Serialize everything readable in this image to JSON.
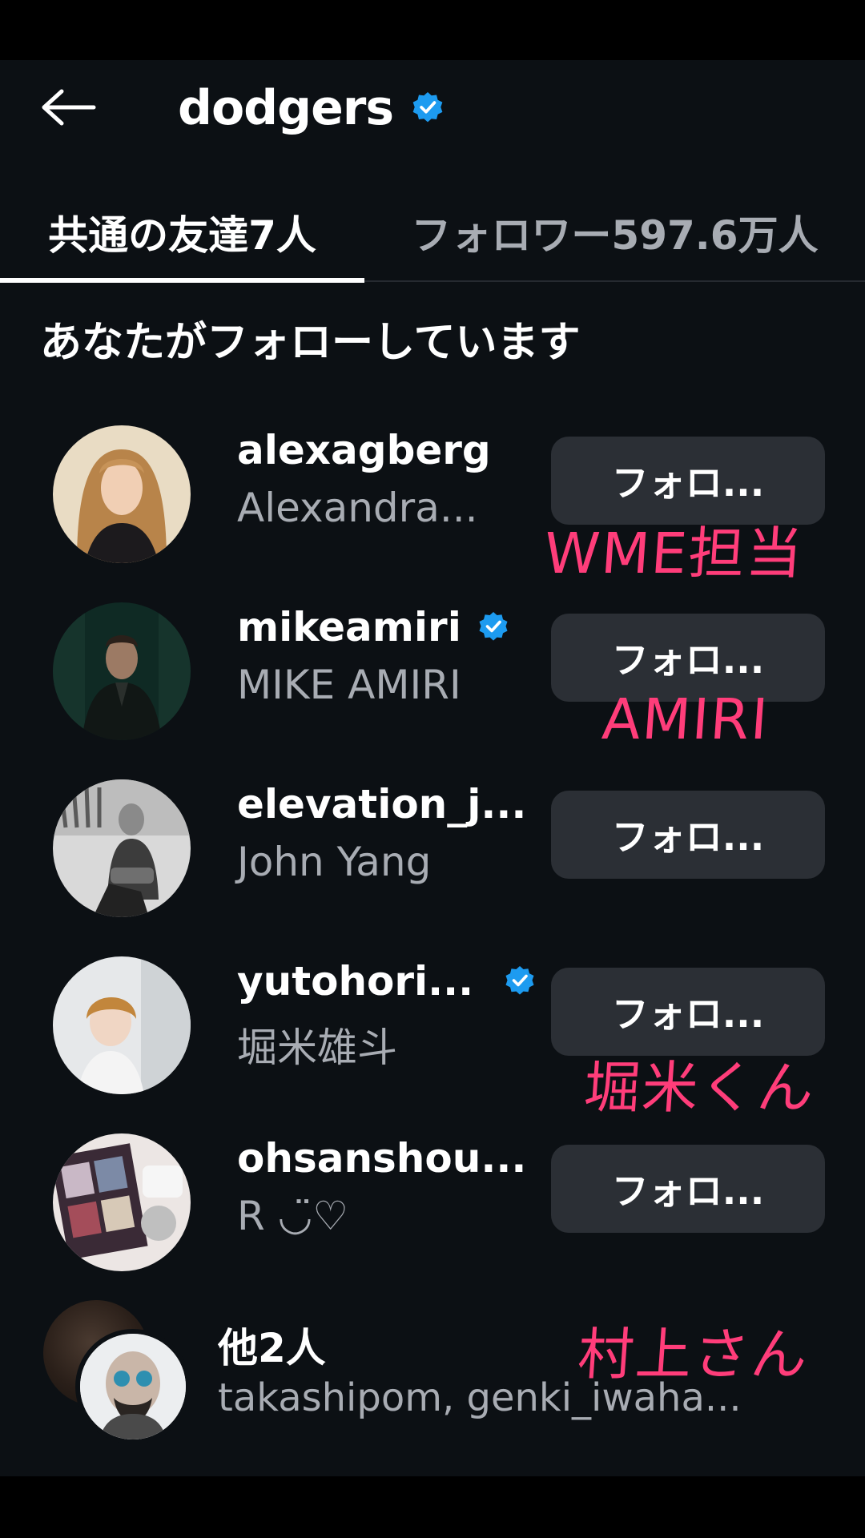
{
  "header": {
    "title": "dodgers",
    "back_icon": "arrow-left-icon",
    "verified_icon": "verified-badge-icon",
    "verified_color": "#0095f6"
  },
  "tabs": [
    {
      "label": "共通の友達7人",
      "active": true
    },
    {
      "label": "フォロワー597.6万人",
      "active": false
    }
  ],
  "section_heading": "あなたがフォローしています",
  "accounts": [
    {
      "username": "alexagberg",
      "full_name": "Alexandra...",
      "verified": false,
      "button": "フォロ..."
    },
    {
      "username": "mikeamiri",
      "full_name": "MIKE AMIRI",
      "verified": true,
      "button": "フォロ..."
    },
    {
      "username": "elevation_j...",
      "full_name": "John Yang",
      "verified": false,
      "button": "フォロ..."
    },
    {
      "username": "yutohori...",
      "full_name": "堀米雄斗",
      "verified": true,
      "button": "フォロ..."
    },
    {
      "username": "ohsanshou...",
      "full_name": "R ◡̈♡",
      "verified": false,
      "button": "フォロ..."
    }
  ],
  "others": {
    "title": "他2人",
    "names": "takashipom, genki_iwaha..."
  },
  "annotations": {
    "color": "#ff3d7a",
    "items": [
      "WME担当",
      "AMIRI",
      "堀米くん",
      "村上さん"
    ]
  }
}
